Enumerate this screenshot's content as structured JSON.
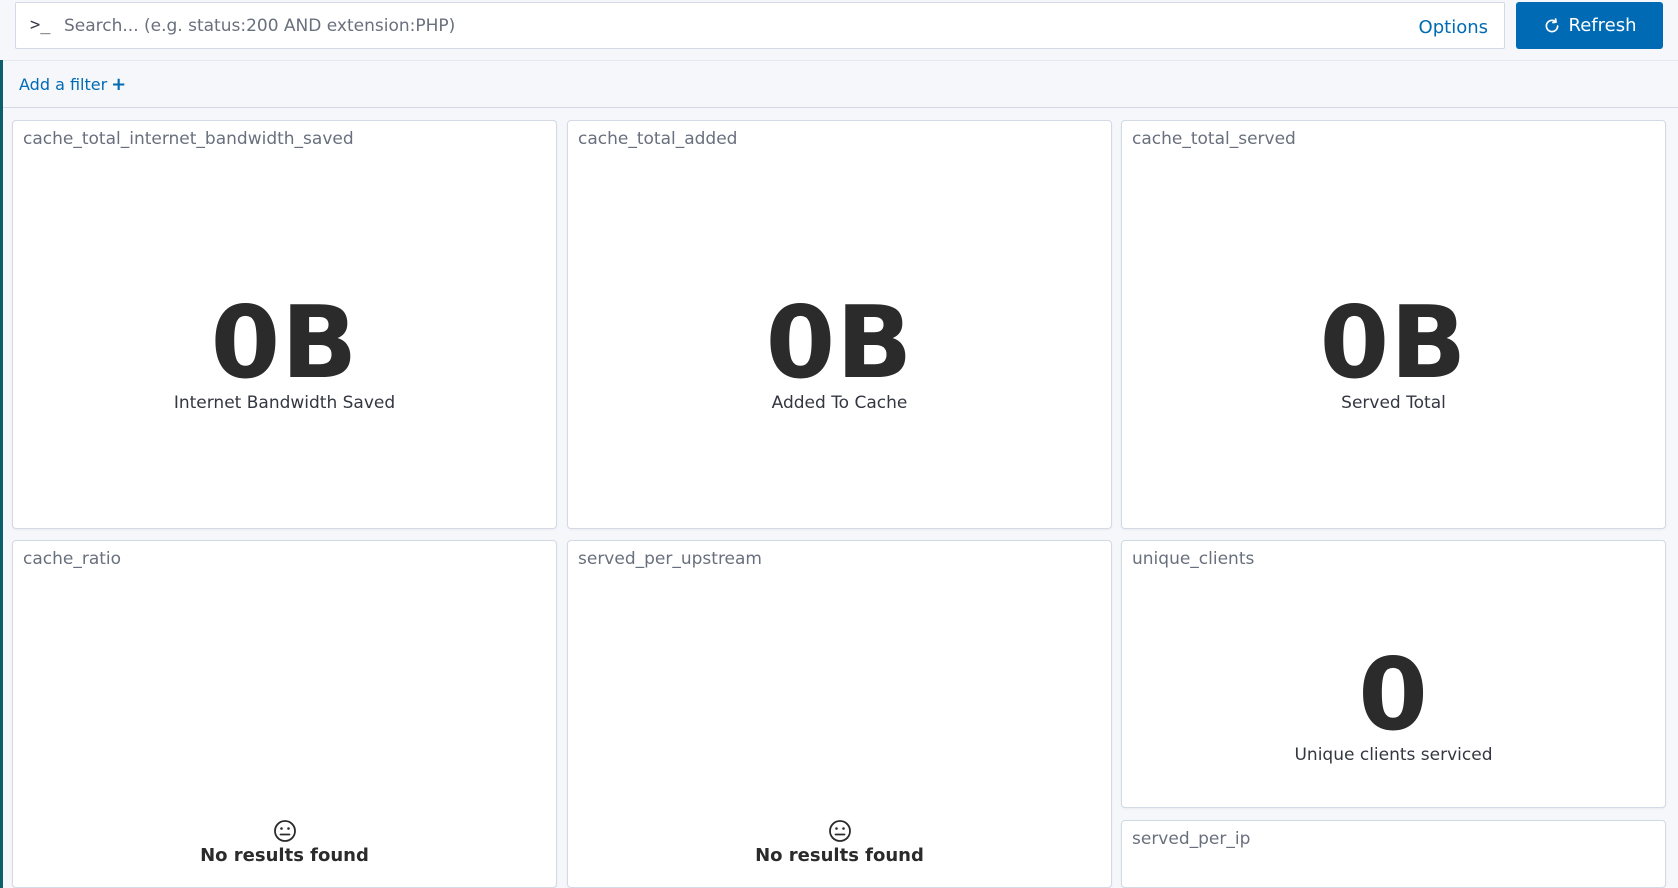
{
  "query_bar": {
    "prompt_symbol": ">_",
    "search_placeholder": "Search... (e.g. status:200 AND extension:PHP)",
    "search_value": "",
    "options_label": "Options",
    "refresh_label": "Refresh"
  },
  "filter_bar": {
    "add_filter_label": "Add a filter",
    "plus_symbol": "+"
  },
  "panels": [
    {
      "title": "cache_total_internet_bandwidth_saved",
      "type": "metric",
      "value": "0B",
      "label": "Internet Bandwidth Saved"
    },
    {
      "title": "cache_total_added",
      "type": "metric",
      "value": "0B",
      "label": "Added To Cache"
    },
    {
      "title": "cache_total_served",
      "type": "metric",
      "value": "0B",
      "label": "Served Total"
    },
    {
      "title": "cache_ratio",
      "type": "empty",
      "message": "No results found"
    },
    {
      "title": "served_per_upstream",
      "type": "empty",
      "message": "No results found"
    },
    {
      "title": "unique_clients",
      "type": "metric",
      "value": "0",
      "label": "Unique clients serviced"
    },
    {
      "title": "served_per_ip",
      "type": "empty",
      "message": ""
    }
  ],
  "colors": {
    "accent": "#006bb4",
    "page_background": "#f5f7fa",
    "panel_border": "#d3dae6",
    "title_text": "#69707d",
    "value_text": "#2b2b2b"
  },
  "icons": {
    "prompt": "terminal-prompt-icon",
    "refresh": "refresh-icon",
    "add_filter": "plus-icon",
    "empty_state": "neutral-face-icon"
  }
}
